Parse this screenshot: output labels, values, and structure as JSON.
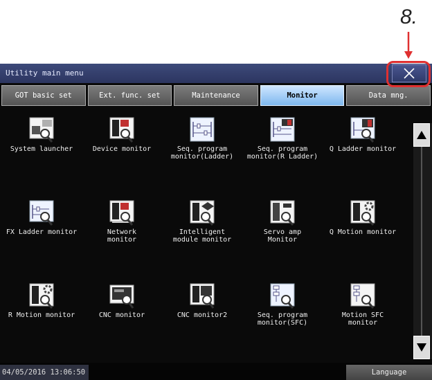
{
  "annotation": {
    "number": "8."
  },
  "window": {
    "title": "Utility main menu",
    "close_icon": "close-x-icon"
  },
  "tabs": [
    {
      "label": "GOT basic set",
      "active": false
    },
    {
      "label": "Ext. func. set",
      "active": false
    },
    {
      "label": "Maintenance",
      "active": false
    },
    {
      "label": "Monitor",
      "active": true
    },
    {
      "label": "Data mng.",
      "active": false
    }
  ],
  "items": [
    {
      "label": "System launcher",
      "icon": "system-launcher-icon"
    },
    {
      "label": "Device monitor",
      "icon": "device-monitor-icon"
    },
    {
      "label": "Seq. program\nmonitor(Ladder)",
      "icon": "ladder-monitor-icon"
    },
    {
      "label": "Seq. program\nmonitor(R Ladder)",
      "icon": "r-ladder-monitor-icon"
    },
    {
      "label": "Q Ladder monitor",
      "icon": "q-ladder-monitor-icon"
    },
    {
      "label": "FX Ladder monitor",
      "icon": "fx-ladder-monitor-icon"
    },
    {
      "label": "Network\nmonitor",
      "icon": "network-monitor-icon"
    },
    {
      "label": "Intelligent\nmodule monitor",
      "icon": "intelligent-module-monitor-icon"
    },
    {
      "label": "Servo amp\nMonitor",
      "icon": "servo-amp-monitor-icon"
    },
    {
      "label": "Q Motion monitor",
      "icon": "q-motion-monitor-icon"
    },
    {
      "label": "R Motion monitor",
      "icon": "r-motion-monitor-icon"
    },
    {
      "label": "CNC monitor",
      "icon": "cnc-monitor-icon"
    },
    {
      "label": "CNC monitor2",
      "icon": "cnc-monitor2-icon"
    },
    {
      "label": "Seq. program\nmonitor(SFC)",
      "icon": "sfc-monitor-icon"
    },
    {
      "label": "Motion SFC\nmonitor",
      "icon": "motion-sfc-monitor-icon"
    }
  ],
  "scrollbar": {
    "up_icon": "scroll-up-icon",
    "down_icon": "scroll-down-icon"
  },
  "status": {
    "datetime": "04/05/2016 13:06:50",
    "language_label": "Language"
  },
  "colors": {
    "annotation_red": "#e03030",
    "active_tab": "#9fcaf5",
    "titlebar": "#34406e"
  }
}
